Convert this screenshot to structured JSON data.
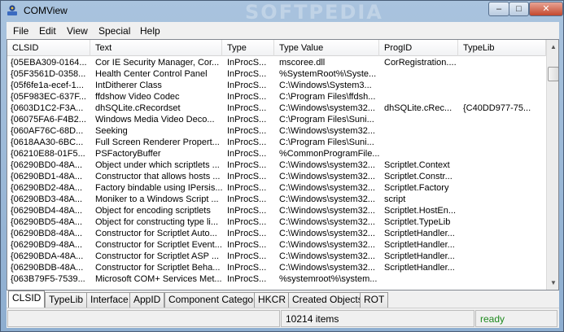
{
  "window": {
    "title": "COMView",
    "watermark": "SOFTPEDIA",
    "buttons": {
      "minimize": "–",
      "maximize": "□",
      "close": "✕"
    }
  },
  "menu": [
    "File",
    "Edit",
    "View",
    "Special",
    "Help"
  ],
  "columns": [
    "CLSID",
    "Text",
    "Type",
    "Type Value",
    "ProgID",
    "TypeLib"
  ],
  "rows": [
    [
      "{05EBA309-0164...",
      "Cor IE Security Manager, Cor...",
      "InProcS...",
      "mscoree.dll",
      "CorRegistration....",
      ""
    ],
    [
      "{05F3561D-0358...",
      "Health Center Control Panel",
      "InProcS...",
      "%SystemRoot%\\Syste...",
      "",
      ""
    ],
    [
      "{05f6fe1a-ecef-1...",
      "IntDitherer Class",
      "InProcS...",
      "C:\\Windows\\System3...",
      "",
      ""
    ],
    [
      "{05F983EC-637F...",
      "ffdshow Video Codec",
      "InProcS...",
      "C:\\Program Files\\ffdsh...",
      "",
      ""
    ],
    [
      "{0603D1C2-F3A...",
      "dhSQLite.cRecordset",
      "InProcS...",
      "C:\\Windows\\system32...",
      "dhSQLite.cRec...",
      "{C40DD977-75..."
    ],
    [
      "{06075FA6-F4B2...",
      "Windows Media Video Deco...",
      "InProcS...",
      "C:\\Program Files\\Suni...",
      "",
      ""
    ],
    [
      "{060AF76C-68D...",
      "Seeking",
      "InProcS...",
      "C:\\Windows\\system32...",
      "",
      ""
    ],
    [
      "{0618AA30-6BC...",
      "Full Screen Renderer Propert...",
      "InProcS...",
      "C:\\Program Files\\Suni...",
      "",
      ""
    ],
    [
      "{06210E88-01F5...",
      "PSFactoryBuffer",
      "InProcS...",
      "%CommonProgramFile...",
      "",
      ""
    ],
    [
      "{06290BD0-48A...",
      "Object under which scriptlets ...",
      "InProcS...",
      "C:\\Windows\\system32...",
      "Scriptlet.Context",
      ""
    ],
    [
      "{06290BD1-48A...",
      "Constructor that allows hosts ...",
      "InProcS...",
      "C:\\Windows\\system32...",
      "Scriptlet.Constr...",
      ""
    ],
    [
      "{06290BD2-48A...",
      "Factory bindable using IPersis...",
      "InProcS...",
      "C:\\Windows\\system32...",
      "Scriptlet.Factory",
      ""
    ],
    [
      "{06290BD3-48A...",
      "Moniker to a Windows Script ...",
      "InProcS...",
      "C:\\Windows\\system32...",
      "script",
      ""
    ],
    [
      "{06290BD4-48A...",
      "Object for encoding scriptlets",
      "InProcS...",
      "C:\\Windows\\system32...",
      "Scriptlet.HostEn...",
      ""
    ],
    [
      "{06290BD5-48A...",
      "Object for constructing type li...",
      "InProcS...",
      "C:\\Windows\\system32...",
      "Scriptlet.TypeLib",
      ""
    ],
    [
      "{06290BD8-48A...",
      "Constructor for Scriptlet Auto...",
      "InProcS...",
      "C:\\Windows\\system32...",
      "ScriptletHandler...",
      ""
    ],
    [
      "{06290BD9-48A...",
      "Constructor for Scriptlet Event...",
      "InProcS...",
      "C:\\Windows\\system32...",
      "ScriptletHandler...",
      ""
    ],
    [
      "{06290BDA-48A...",
      "Constructor for Scriptlet ASP ...",
      "InProcS...",
      "C:\\Windows\\system32...",
      "ScriptletHandler...",
      ""
    ],
    [
      "{06290BDB-48A...",
      "Constructor for Scriptlet Beha...",
      "InProcS...",
      "C:\\Windows\\system32...",
      "ScriptletHandler...",
      ""
    ],
    [
      "{063B79F5-7539...",
      "Microsoft COM+ Services Met...",
      "InProcS...",
      "%systemroot%\\system...",
      "",
      ""
    ]
  ],
  "tabs": [
    "CLSID",
    "TypeLib",
    "Interface",
    "AppID",
    "Component Category",
    "HKCR",
    "Created Objects",
    "ROT"
  ],
  "status": {
    "count": "10214 items",
    "state": "ready"
  }
}
